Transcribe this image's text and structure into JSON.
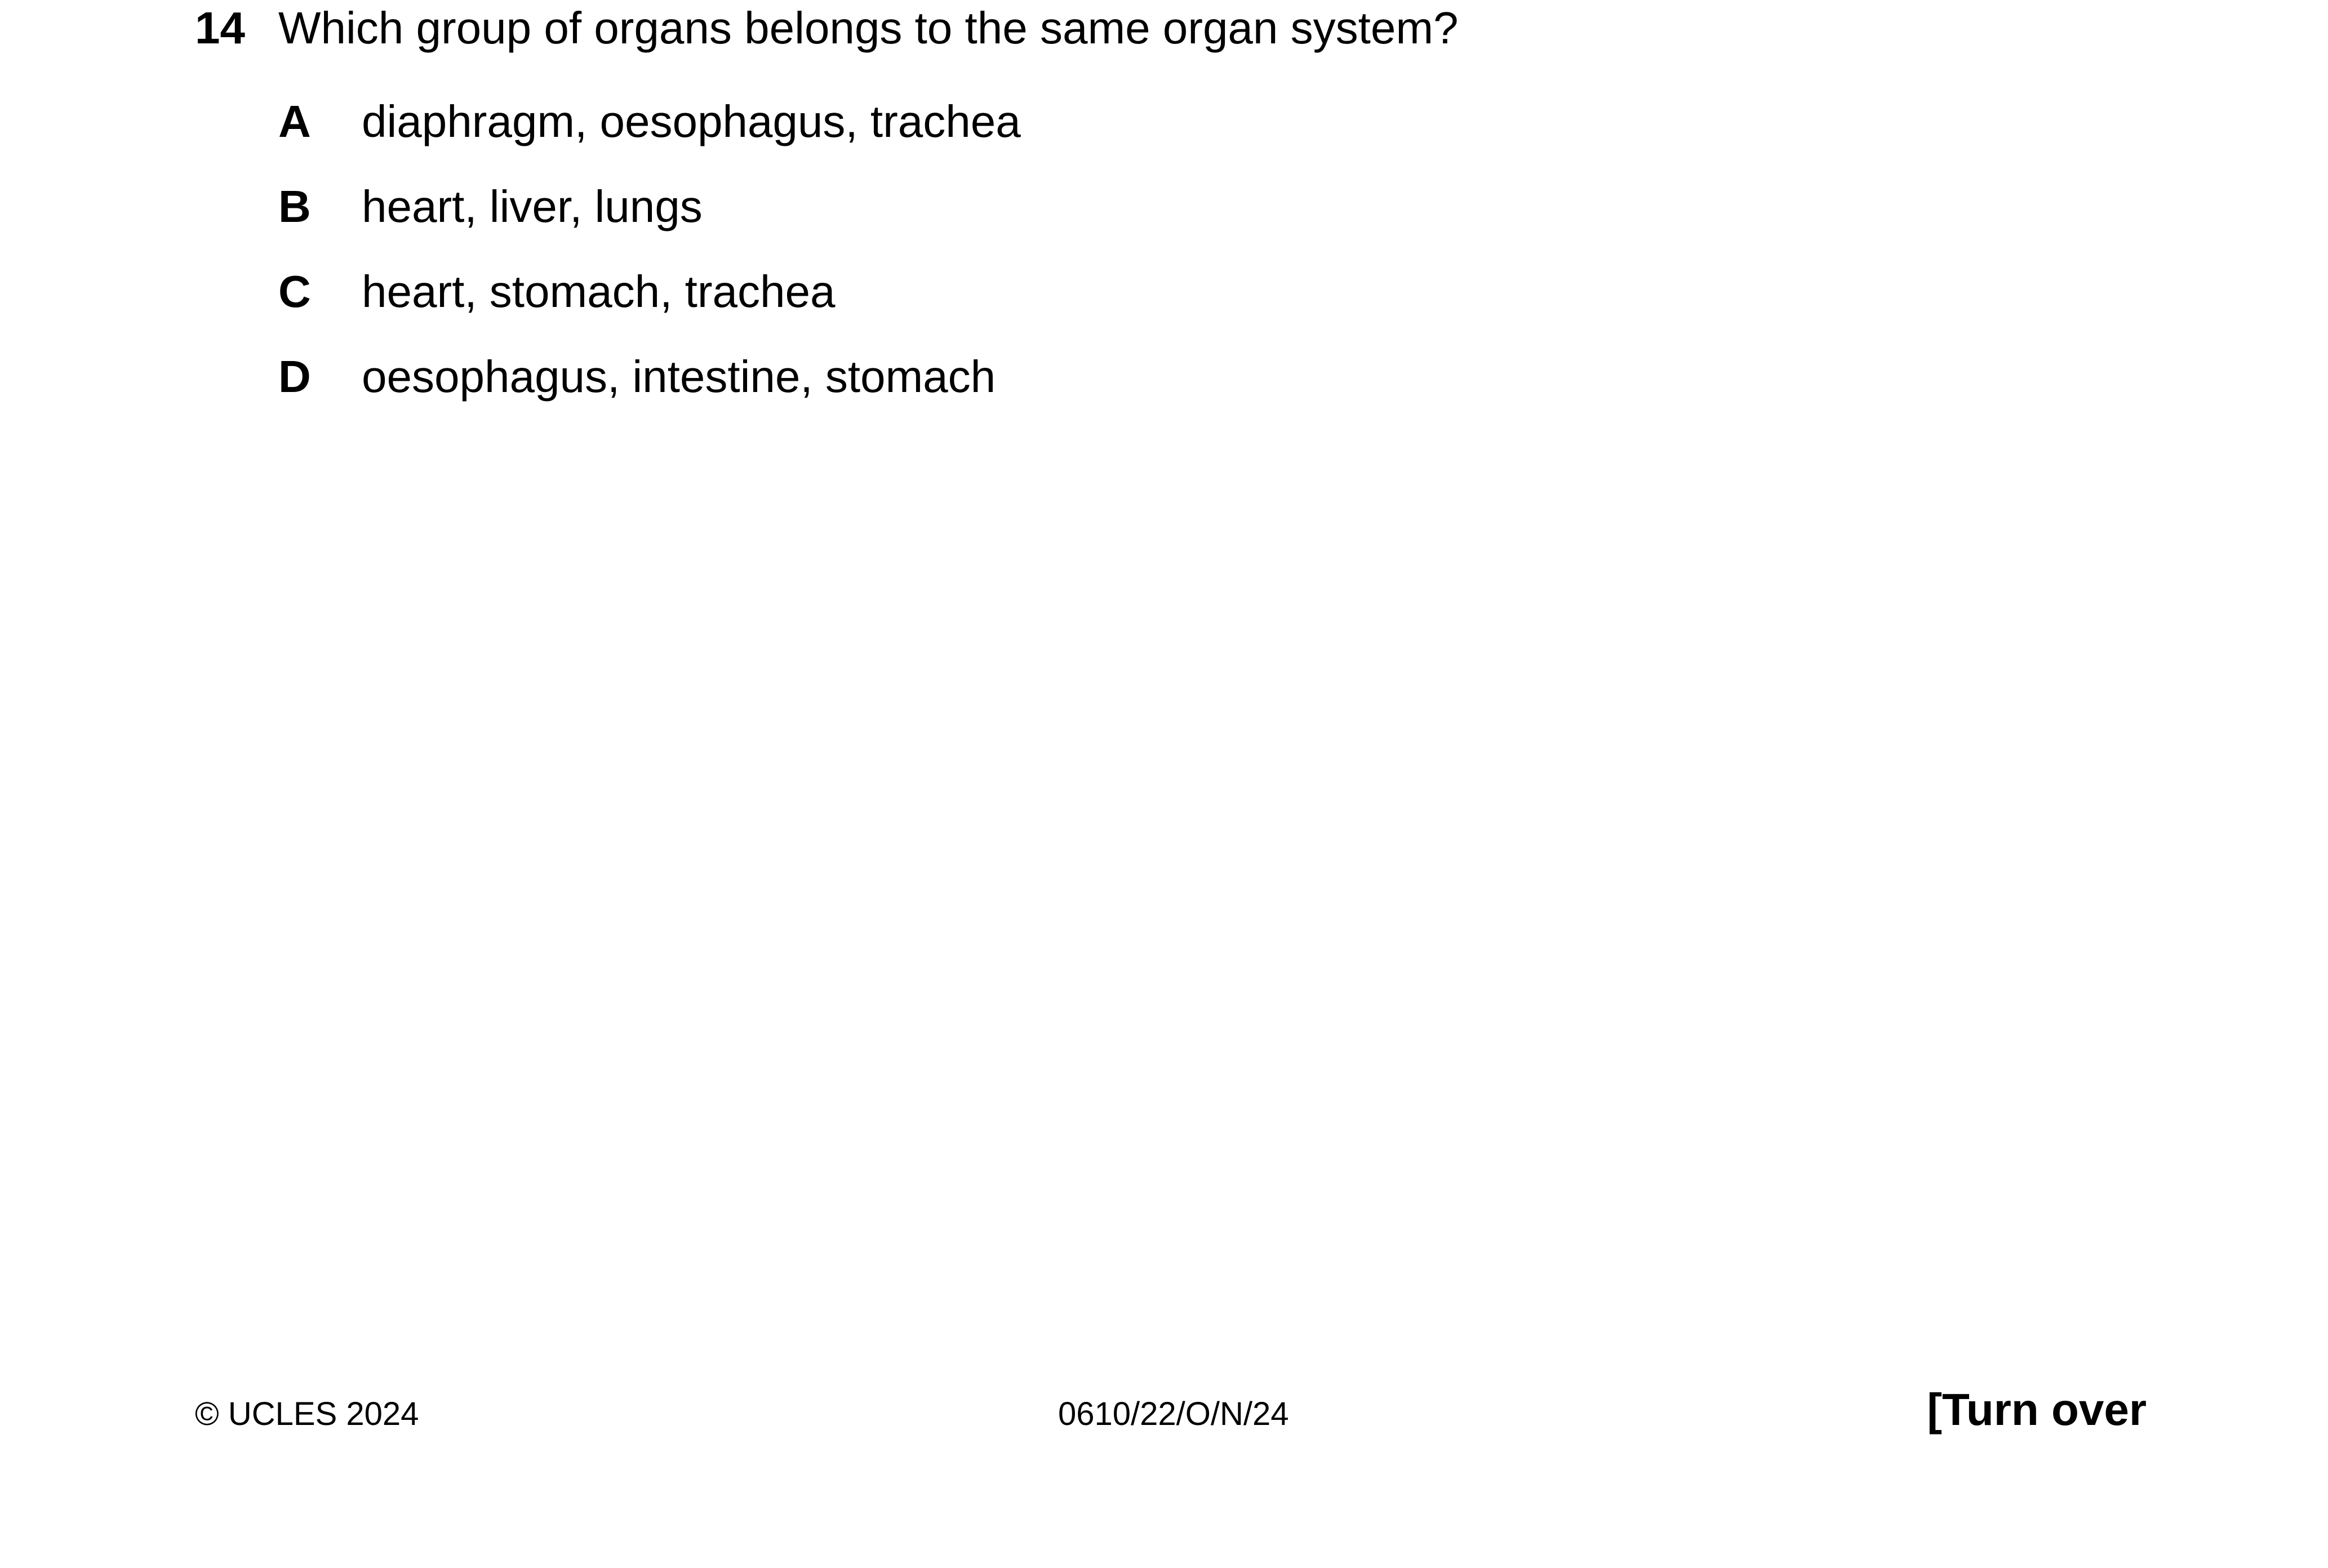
{
  "question": {
    "number": "14",
    "text": "Which group of organs belongs to the same organ system?",
    "options": [
      {
        "letter": "A",
        "text": "diaphragm, oesophagus, trachea"
      },
      {
        "letter": "B",
        "text": "heart, liver, lungs"
      },
      {
        "letter": "C",
        "text": "heart, stomach, trachea"
      },
      {
        "letter": "D",
        "text": "oesophagus, intestine, stomach"
      }
    ]
  },
  "footer": {
    "copyright": "© UCLES 2024",
    "code": "0610/22/O/N/24",
    "turn_over": "[Turn over"
  }
}
